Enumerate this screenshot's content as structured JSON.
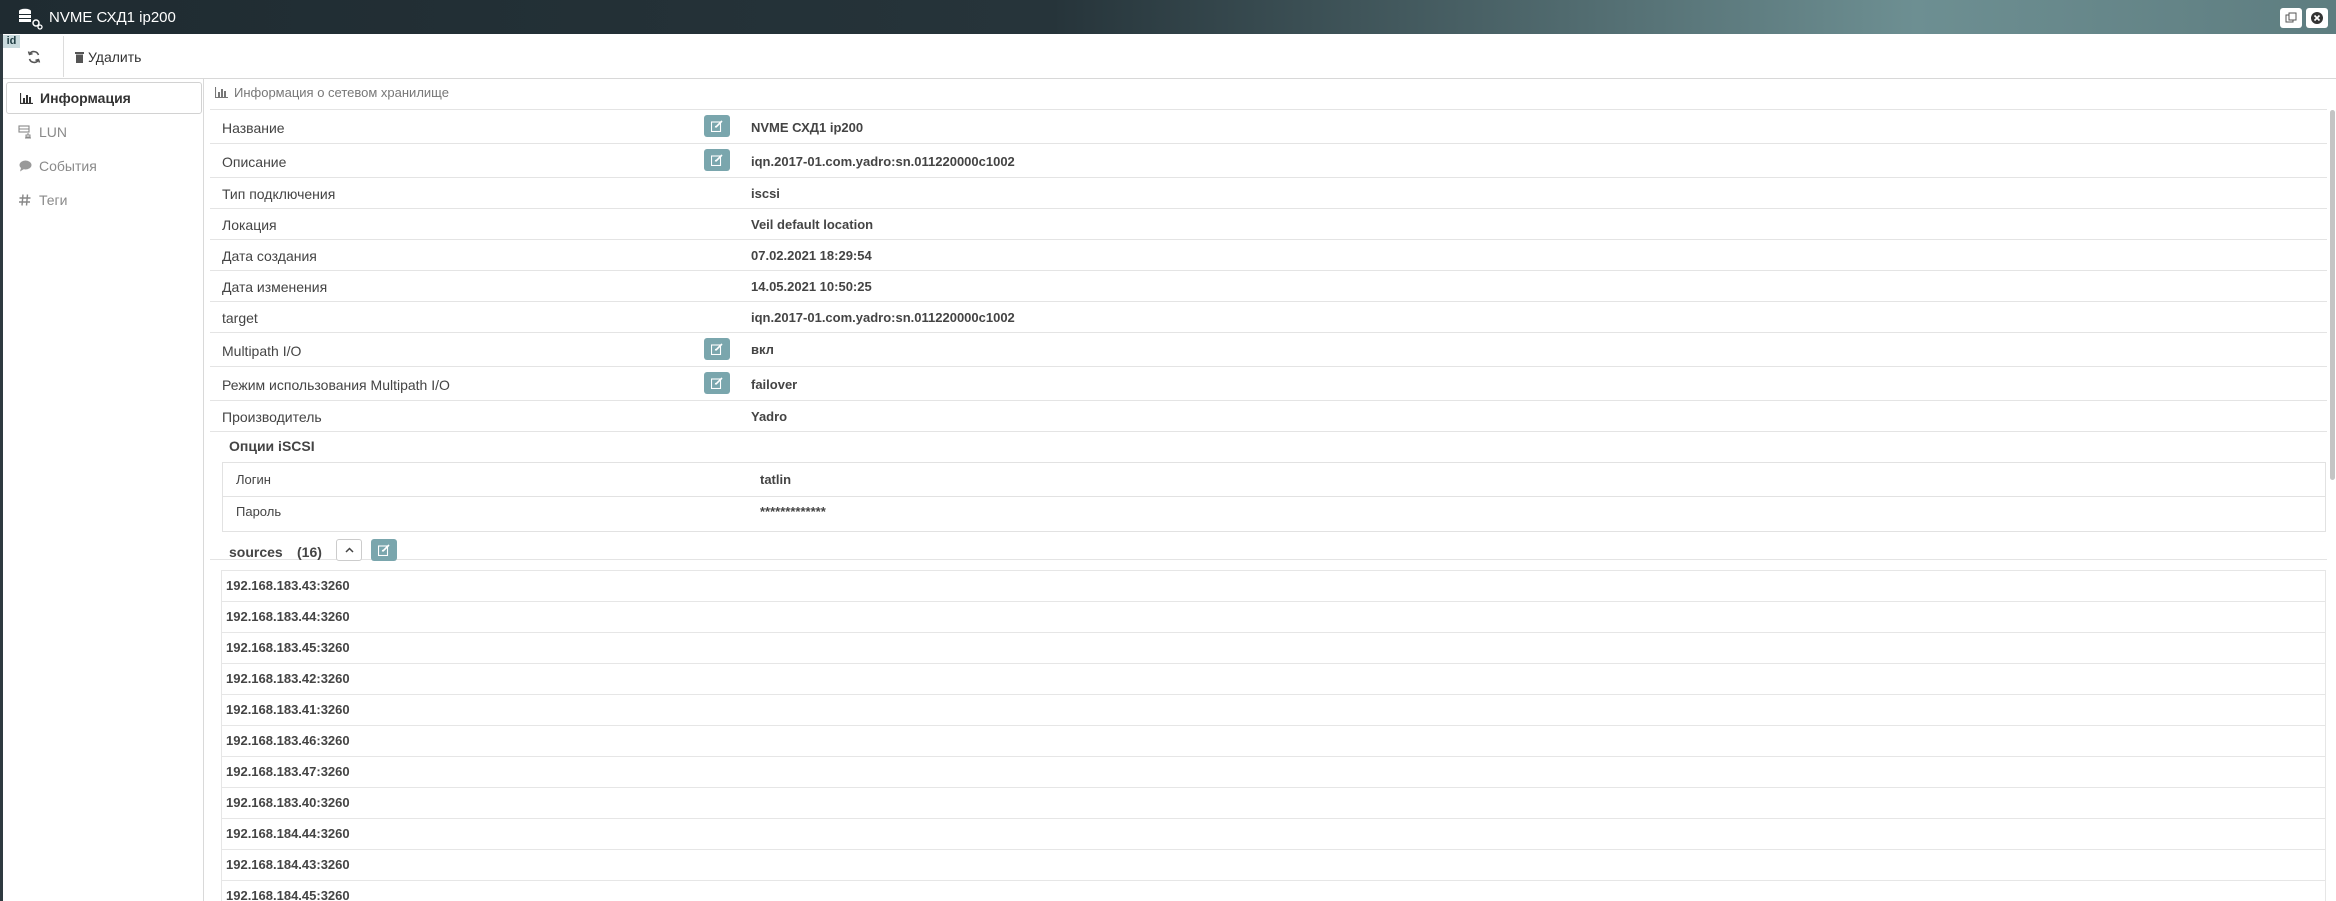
{
  "window": {
    "title": "NVME СХД1 ip200",
    "id_badge": "id"
  },
  "toolbar": {
    "delete_label": "Удалить"
  },
  "sidebar": {
    "items": [
      {
        "label": "Информация",
        "icon": "bar-chart-icon",
        "active": true
      },
      {
        "label": "LUN",
        "icon": "lun-icon",
        "active": false
      },
      {
        "label": "События",
        "icon": "comment-icon",
        "active": false
      },
      {
        "label": "Теги",
        "icon": "hash-icon",
        "active": false
      }
    ]
  },
  "main": {
    "section_title": "Информация о сетевом хранилище",
    "fields": [
      {
        "label": "Название",
        "value": "NVME СХД1 ip200",
        "editable": true
      },
      {
        "label": "Описание",
        "value": "iqn.2017-01.com.yadro:sn.011220000c1002",
        "editable": true
      },
      {
        "label": "Тип подключения",
        "value": "iscsi",
        "editable": false
      },
      {
        "label": "Локация",
        "value": "Veil default location",
        "editable": false
      },
      {
        "label": "Дата создания",
        "value": "07.02.2021 18:29:54",
        "editable": false
      },
      {
        "label": "Дата изменения",
        "value": "14.05.2021 10:50:25",
        "editable": false
      },
      {
        "label": "target",
        "value": "iqn.2017-01.com.yadro:sn.011220000c1002",
        "editable": false
      },
      {
        "label": "Multipath I/O",
        "value": "вкл",
        "editable": true
      },
      {
        "label": "Режим использования Multipath I/O",
        "value": "failover",
        "editable": true
      },
      {
        "label": "Производитель",
        "value": "Yadro",
        "editable": false
      }
    ],
    "iscsi": {
      "title": "Опции iSCSI",
      "fields": [
        {
          "label": "Логин",
          "value": "tatlin"
        },
        {
          "label": "Пароль",
          "value": "*************"
        }
      ]
    },
    "sources": {
      "title": "sources",
      "count": "(16)",
      "items": [
        "192.168.183.43:3260",
        "192.168.183.44:3260",
        "192.168.183.45:3260",
        "192.168.183.42:3260",
        "192.168.183.41:3260",
        "192.168.183.46:3260",
        "192.168.183.47:3260",
        "192.168.183.40:3260",
        "192.168.184.44:3260",
        "192.168.184.43:3260",
        "192.168.184.45:3260"
      ]
    }
  },
  "colors": {
    "edit_button": "#7aa6ad",
    "title_bar_dark": "#1f2b31",
    "title_bar_light": "#6d8f92"
  }
}
